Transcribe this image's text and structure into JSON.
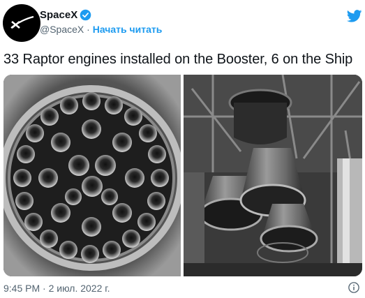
{
  "account": {
    "name": "SpaceX",
    "handle": "@SpaceX",
    "separator": "·",
    "follow_label": "Начать читать"
  },
  "tweet": {
    "text": "33 Raptor engines installed on the Booster, 6 on the Ship",
    "time": "9:45 PM",
    "date_separator": "·",
    "date": "2 июл. 2022 г."
  },
  "colors": {
    "accent": "#1d9bf0",
    "secondary_text": "#536471",
    "primary_text": "#0f1419"
  },
  "icons": {
    "verified": "verified-badge-icon",
    "brand": "twitter-bird-icon",
    "info": "info-circle-icon"
  }
}
